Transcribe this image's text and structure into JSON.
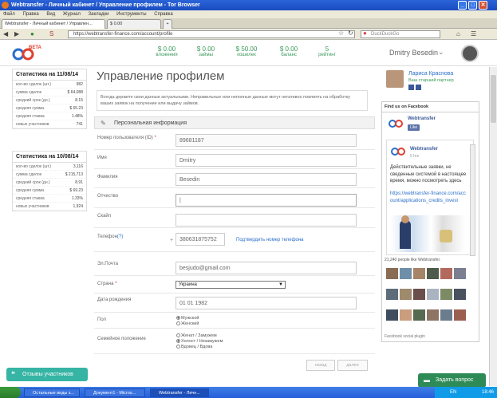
{
  "window": {
    "title": "Webtransfer - Личный кабинет / Управление профилем - Tor Browser",
    "min": "_",
    "max": "□",
    "close": "✕"
  },
  "menu": [
    "Файл",
    "Правка",
    "Вид",
    "Журнал",
    "Закладки",
    "Инструменты",
    "Справка"
  ],
  "tabs": [
    {
      "label": "Webtransfer - Личный кабинет / Управлен..."
    },
    {
      "label": "$ 0.00",
      "new": "+"
    }
  ],
  "browser": {
    "url": "https://webtransfer-finance.com/account/profile",
    "search_placeholder": "DuckDuckGo"
  },
  "header": {
    "logo_badge": "BETA",
    "stats": [
      {
        "value": "$ 0.00",
        "label": "вложения"
      },
      {
        "value": "$ 0.00",
        "label": "займы"
      },
      {
        "value": "$ 50.00",
        "label": "кошелек"
      },
      {
        "value": "$ 0.00",
        "label": "баланс"
      },
      {
        "value": "5",
        "label": "рейтинг"
      }
    ],
    "user": "Dmitry Besedin"
  },
  "stats_boxes": [
    {
      "title": "Статистика на 11/08/14",
      "rows": [
        {
          "k": "кол-во сделок (шт.)",
          "v": "982"
        },
        {
          "k": "сумма сделок",
          "v": "$ 64,088"
        },
        {
          "k": "средний срок (дн.)",
          "v": "8.15"
        },
        {
          "k": "средняя сумма",
          "v": "$ 65.23"
        },
        {
          "k": "средняя ставка",
          "v": "1.48%"
        },
        {
          "k": "новых участников",
          "v": "741"
        }
      ]
    },
    {
      "title": "Статистика на 10/08/14",
      "rows": [
        {
          "k": "кол-во сделок (шт.)",
          "v": "3,116"
        },
        {
          "k": "сумма сделок",
          "v": "$ 215,713"
        },
        {
          "k": "средний срок (дн.)",
          "v": "8.91"
        },
        {
          "k": "средняя сумма",
          "v": "$ 69.23"
        },
        {
          "k": "средняя ставка",
          "v": "1.33%"
        },
        {
          "k": "новых участников",
          "v": "1,924"
        }
      ]
    }
  ],
  "main": {
    "title": "Управление профилем",
    "notice": "Всегда держите свои данные актуальными. Неправильные или неполные данные могут негативно повлиять на обработку ваших заявок на получение или выдачу займов.",
    "section": "Персональная информация",
    "fields": {
      "uid_label": "Номер пользователя (ID)",
      "uid_value": "89681187",
      "name_label": "Имя",
      "name_value": "Dmitry",
      "surname_label": "Фамилия",
      "surname_value": "Besedin",
      "patronymic_label": "Отчество",
      "patronymic_value": "|",
      "skype_label": "Скайп",
      "skype_value": "",
      "phone_label": "Телефон",
      "phone_help": "(?)",
      "phone_plus": "+",
      "phone_value": "380631875752",
      "phone_link": "Подтвердить номер телефона",
      "email_label": "Эл.Почта",
      "email_value": "besjudo@gmail.com",
      "country_label": "Страна",
      "country_value": "Украина",
      "birth_label": "Дата рождения",
      "birth_value": "01 01 1982",
      "sex_label": "Пол",
      "sex_opts": [
        "Мужской",
        "Женский"
      ],
      "marital_label": "Семейное положение",
      "marital_opts": [
        "Женат / Замужем",
        "Холост / Незамужем",
        "Вдовец / Вдова"
      ]
    },
    "btn_back": "назад",
    "btn_next": "далее"
  },
  "right": {
    "partner_name": "Лариса Краснова",
    "partner_role": "Ваш старший партнер",
    "fb_title": "Find us on Facebook",
    "fb_page": "Webtransfer",
    "fb_like": "Like",
    "post_author": "Webtransfer",
    "post_time": "5 hrs",
    "post_text": "Действительные заявки, не сведенные системой в настоящее время, можно посмотреть здесь",
    "post_link": "https://webtransfer-finance.com/account/applications_credits_invest",
    "likes": "21,240 people like Webtransfer.",
    "plugin": "Facebook social plugin"
  },
  "bottom": {
    "feedback": "Отзывы участников",
    "ask": "Задать вопрос"
  },
  "taskbar": {
    "items": [
      "Остальные виды з...",
      "Документ1 - Micros...",
      "Webtransfer - Личн..."
    ],
    "lang": "EN",
    "time": "18:46"
  }
}
